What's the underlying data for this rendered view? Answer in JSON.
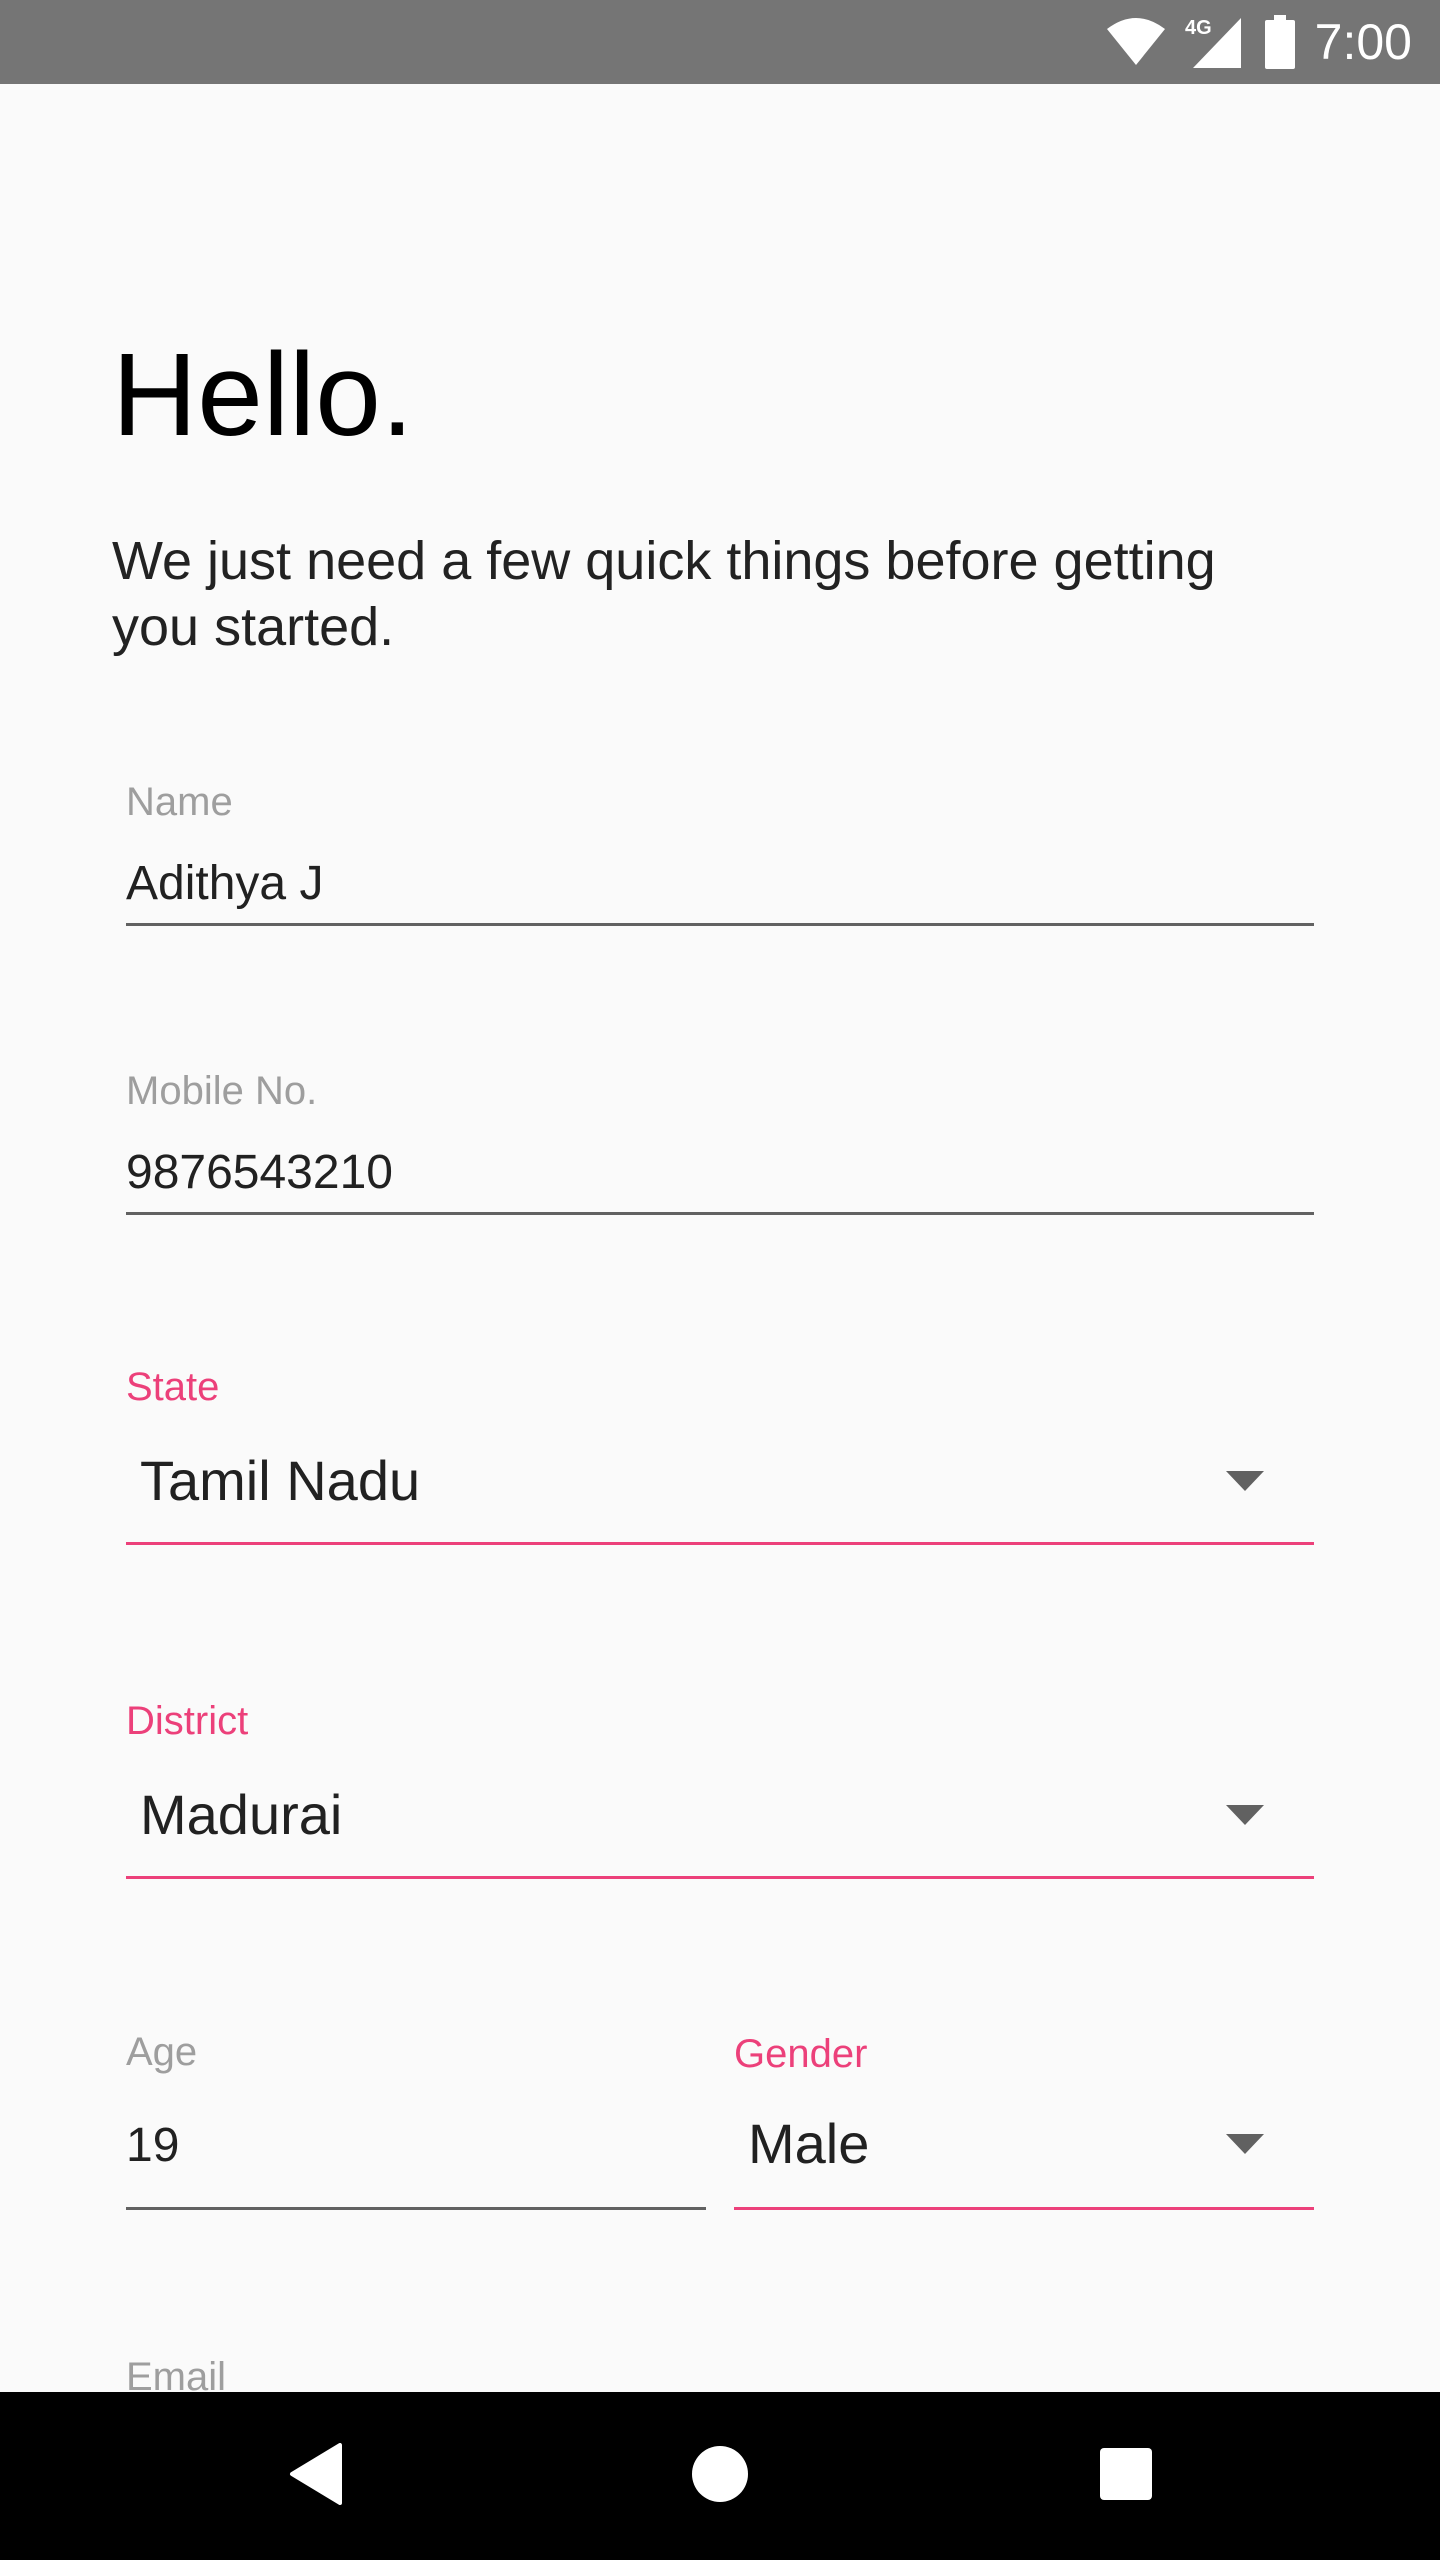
{
  "status_bar": {
    "time": "7:00",
    "network_label": "4G",
    "icons": [
      "wifi-icon",
      "cellular-signal-icon",
      "battery-icon"
    ]
  },
  "header": {
    "greeting": "Hello.",
    "subtitle": "We just need a few quick things before getting you started."
  },
  "form": {
    "name": {
      "label": "Name",
      "value": "Adithya J"
    },
    "mobile": {
      "label": "Mobile No.",
      "value": "9876543210"
    },
    "state": {
      "label": "State",
      "value": "Tamil Nadu"
    },
    "district": {
      "label": "District",
      "value": "Madurai"
    },
    "age": {
      "label": "Age",
      "value": "19"
    },
    "gender": {
      "label": "Gender",
      "value": "Male"
    },
    "email": {
      "label": "Email"
    }
  },
  "navigation": {
    "buttons": [
      "back-icon",
      "home-icon",
      "recents-icon"
    ]
  },
  "colors": {
    "accent": "#ec407a",
    "status_bar": "#757575",
    "nav_bar": "#000000",
    "background": "#fafafa"
  }
}
